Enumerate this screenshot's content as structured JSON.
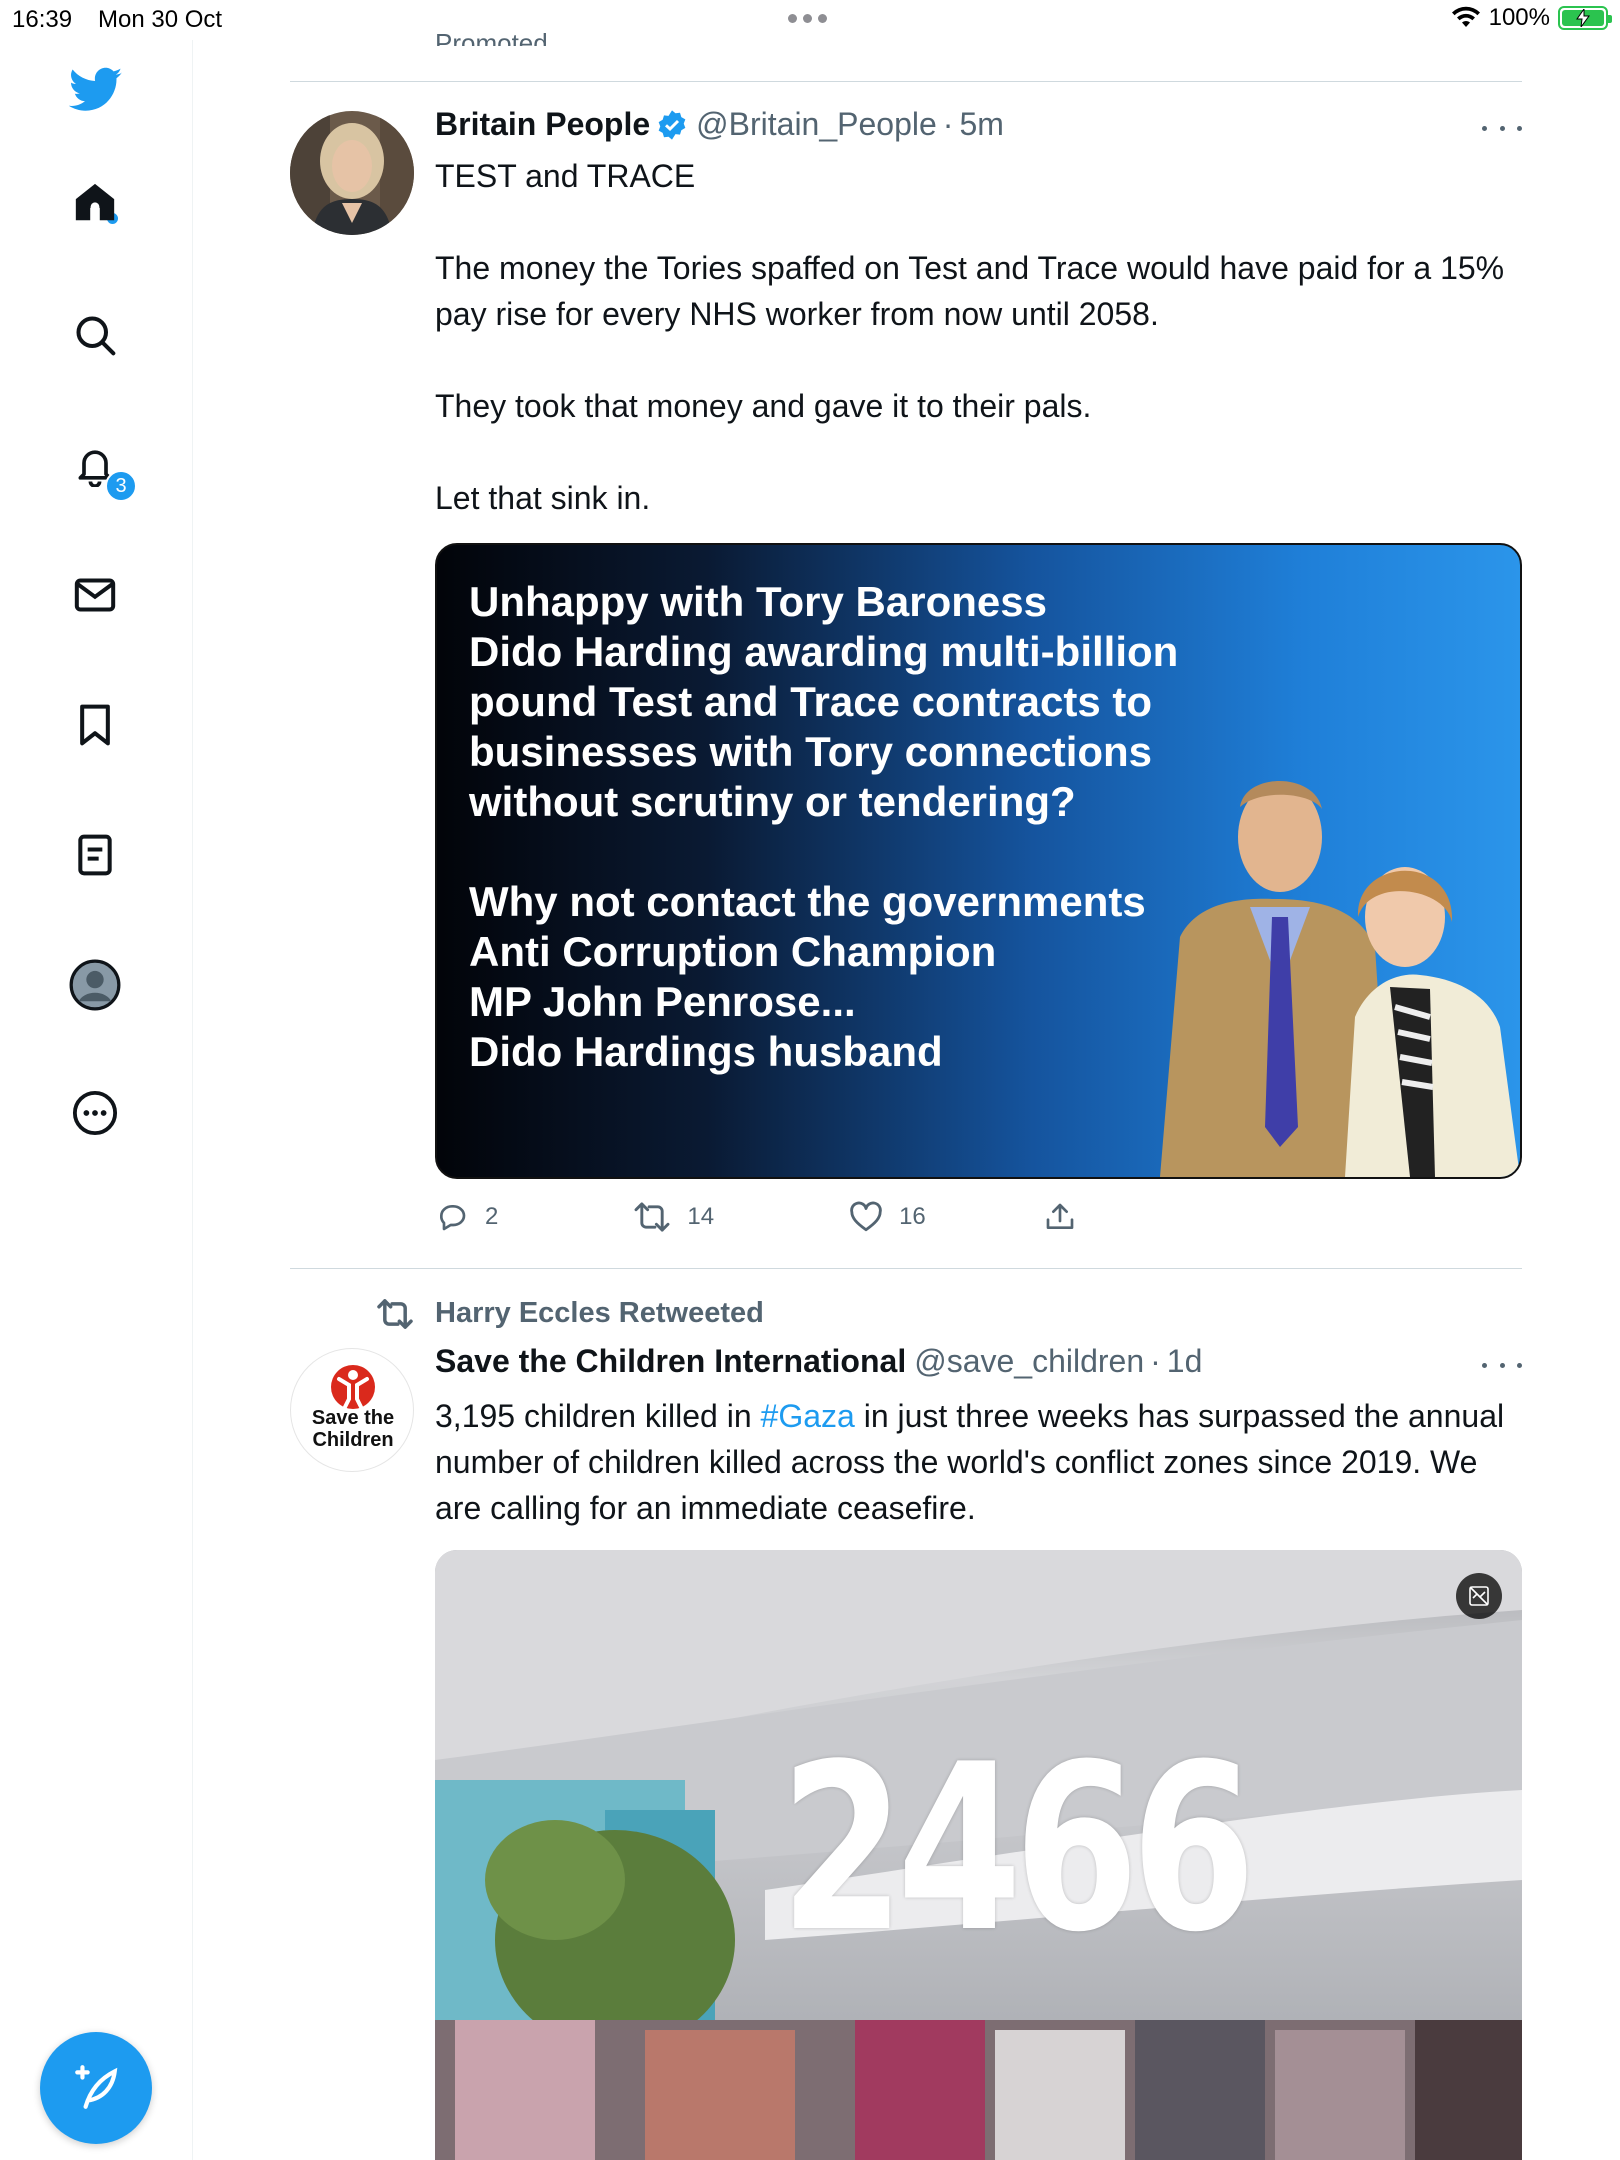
{
  "status_bar": {
    "time": "16:39",
    "date": "Mon 30 Oct",
    "battery": "100%"
  },
  "sidebar": {
    "notifications_count": "3",
    "items": [
      "twitter-logo",
      "home",
      "explore",
      "notifications",
      "messages",
      "bookmarks",
      "lists",
      "profile",
      "more"
    ]
  },
  "feed": {
    "promoted_label": "Promoted",
    "tweets": [
      {
        "name": "Britain People",
        "handle": "@Britain_People",
        "time_sep": "·",
        "time": "5m",
        "text": [
          "TEST and TRACE",
          "The money the Tories spaffed on Test and Trace would have paid for a 15% pay rise for every NHS worker from now until 2058.",
          "They took that money and gave it to their pals.",
          "Let that sink in."
        ],
        "media_text_1": [
          "Unhappy with Tory Baroness",
          "Dido Harding awarding multi-billion",
          "pound Test and Trace contracts to",
          "businesses with Tory connections",
          "without scrutiny or tendering?"
        ],
        "media_text_2": [
          "Why not contact the governments",
          "Anti Corruption Champion",
          "MP John Penrose...",
          "Dido Hardings husband"
        ],
        "replies": "2",
        "retweets": "14",
        "likes": "16"
      },
      {
        "retweeted_by": "Harry Eccles Retweeted",
        "name": "Save the Children International",
        "handle": "@save_children",
        "time_sep": "·",
        "time": "1d",
        "avatar_text_1": "Save the",
        "avatar_text_2": "Children",
        "text_pre": "3,195 children killed in ",
        "hashtag": "#Gaza",
        "text_post": " in just three weeks has surpassed the annual number of children killed across the world's conflict zones since 2019. We are calling for an immediate ceasefire.",
        "media_number": "2466"
      }
    ]
  },
  "colors": {
    "accent": "#1d9bf0",
    "text": "#0f1419",
    "secondary": "#536471",
    "battery": "#2bc34f",
    "save_red": "#da291c"
  }
}
